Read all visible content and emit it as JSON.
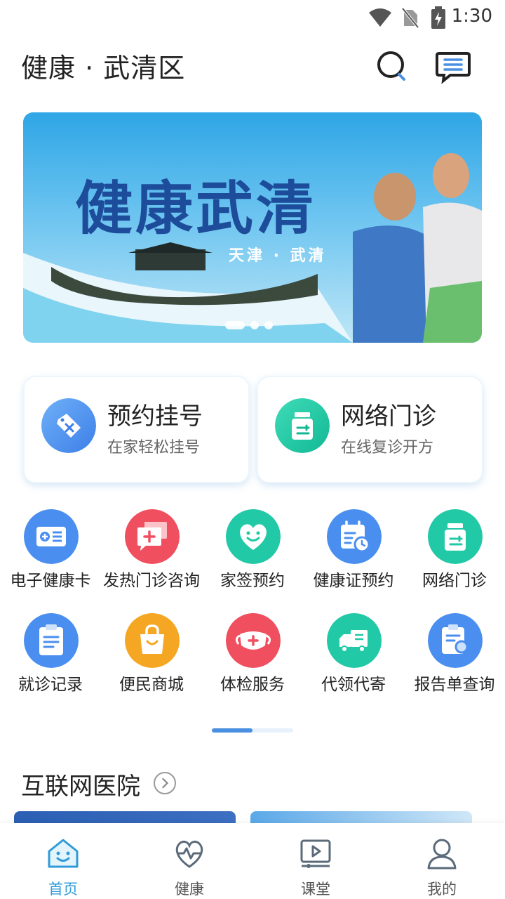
{
  "status_bar": {
    "time": "1:30",
    "icons": [
      "wifi-icon",
      "no-sim-icon",
      "battery-charging-icon"
    ]
  },
  "header": {
    "title": "健康 · 武清区",
    "search_icon": "search-icon",
    "message_icon": "message-icon"
  },
  "banner": {
    "headline": "健康武清",
    "subline": "天津 · 武清",
    "dots": 3,
    "active_dot": 0
  },
  "feature_cards": [
    {
      "title": "预约挂号",
      "subtitle": "在家轻松挂号",
      "icon": "tag-icon",
      "color": "#4a8ff0"
    },
    {
      "title": "网络门诊",
      "subtitle": "在线复诊开方",
      "icon": "medicine-bottle-icon",
      "color": "#22c9a6"
    }
  ],
  "services": [
    {
      "label": "电子健康卡",
      "icon": "health-card-icon",
      "color": "#4a8ff0"
    },
    {
      "label": "发热门诊咨询",
      "icon": "chat-plus-icon",
      "color": "#f04f5f"
    },
    {
      "label": "家签预约",
      "icon": "heart-smile-icon",
      "color": "#22c9a6"
    },
    {
      "label": "健康证预约",
      "icon": "calendar-clock-icon",
      "color": "#4a8ff0"
    },
    {
      "label": "网络门诊",
      "icon": "medicine-bottle-icon",
      "color": "#22c9a6"
    },
    {
      "label": "就诊记录",
      "icon": "clipboard-icon",
      "color": "#4a8ff0"
    },
    {
      "label": "便民商城",
      "icon": "shopping-bag-icon",
      "color": "#f5a623"
    },
    {
      "label": "体检服务",
      "icon": "mask-icon",
      "color": "#f04f5f"
    },
    {
      "label": "代领代寄",
      "icon": "delivery-truck-icon",
      "color": "#22c9a6"
    },
    {
      "label": "报告单查询",
      "icon": "report-search-icon",
      "color": "#4a8ff0"
    }
  ],
  "services_page": {
    "current": 1,
    "total": 2
  },
  "section": {
    "title": "互联网医院",
    "arrow_icon": "chevron-right-icon"
  },
  "tabbar": {
    "items": [
      {
        "label": "首页",
        "icon": "home-smile-icon",
        "active": true
      },
      {
        "label": "健康",
        "icon": "heart-pulse-icon",
        "active": false
      },
      {
        "label": "课堂",
        "icon": "video-play-icon",
        "active": false
      },
      {
        "label": "我的",
        "icon": "user-icon",
        "active": false
      }
    ],
    "active_color": "#2f9bd8"
  }
}
